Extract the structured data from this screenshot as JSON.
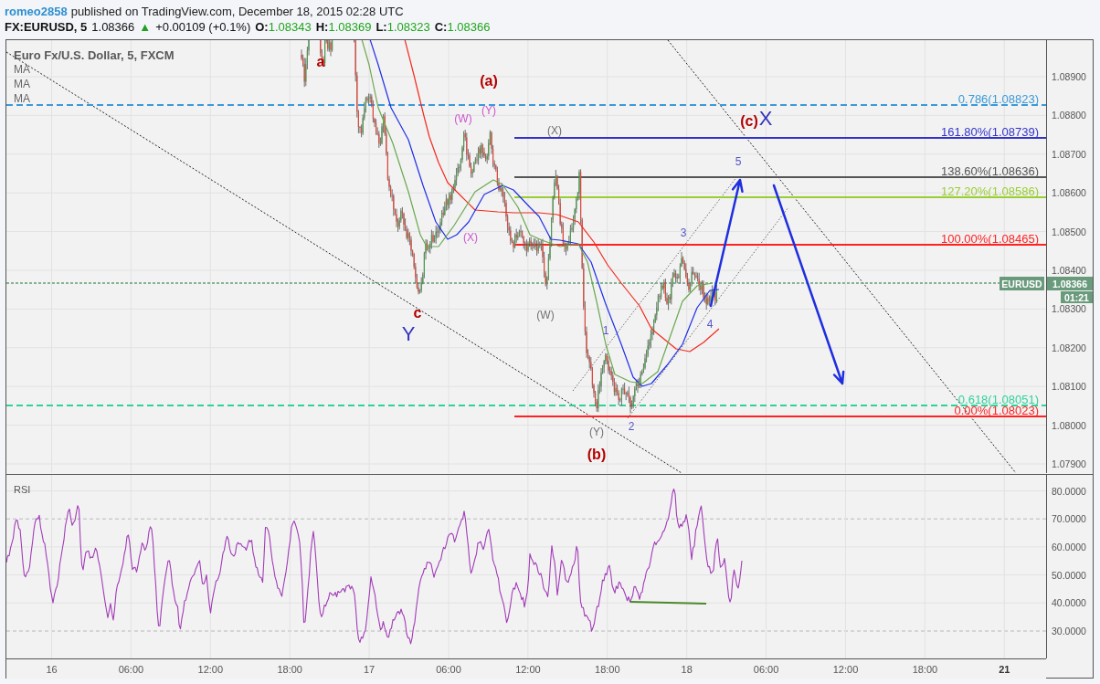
{
  "header": {
    "author": "romeo2858",
    "published": "published on TradingView.com, December 18, 2015 02:28 UTC"
  },
  "quote": {
    "symbol": "FX:EURUSD, 5",
    "last": "1.08366",
    "arrow": "▲",
    "change": "+0.00109 (+0.1%)",
    "ohlc": [
      {
        "label": "O:",
        "value": "1.08343"
      },
      {
        "label": "H:",
        "value": "1.08369"
      },
      {
        "label": "L:",
        "value": "1.08323"
      },
      {
        "label": "C:",
        "value": "1.08366"
      }
    ]
  },
  "price_pane": {
    "title": "Euro Fx/U.S. Dollar, 5, FXCM",
    "indicators": [
      "MA",
      "MA",
      "MA"
    ],
    "levels": [
      {
        "label": "0.786(1.08823)",
        "color": "#3a9ad9",
        "kind": "dashed"
      },
      {
        "label": "161.80%(1.08739)",
        "color": "#3333cc",
        "kind": "solid"
      },
      {
        "label": "138.60%(1.08636)",
        "color": "#555555",
        "kind": "solid"
      },
      {
        "label": "127.20%(1.08586)",
        "color": "#9acd32",
        "kind": "solid"
      },
      {
        "label": "100.00%(1.08465)",
        "color": "#ff2222",
        "kind": "solid"
      },
      {
        "label": "0.618(1.08051)",
        "color": "#2ed39a",
        "kind": "dashed"
      },
      {
        "label": "0.00%(1.08023)",
        "color": "#ff2222",
        "kind": "solid"
      }
    ],
    "wave_labels": [
      {
        "text": "a",
        "color": "#b30000",
        "kind": "bold"
      },
      {
        "text": "(a)",
        "color": "#b30000",
        "kind": "bold"
      },
      {
        "text": "(W)",
        "color": "#cc55cc",
        "kind": "small"
      },
      {
        "text": "(Y)",
        "color": "#cc55cc",
        "kind": "small"
      },
      {
        "text": "(c)",
        "color": "#b30000",
        "kind": "bold"
      },
      {
        "text": "X",
        "color": "#3333bb",
        "kind": "large"
      },
      {
        "text": "(X)",
        "color": "#707070",
        "kind": "small"
      },
      {
        "text": "5",
        "color": "#5555cc",
        "kind": "small"
      },
      {
        "text": "(X)",
        "color": "#cc55cc",
        "kind": "small"
      },
      {
        "text": "3",
        "color": "#5555cc",
        "kind": "small"
      },
      {
        "text": "c",
        "color": "#b30000",
        "kind": "bold"
      },
      {
        "text": "(W)",
        "color": "#707070",
        "kind": "small"
      },
      {
        "text": "4",
        "color": "#5555cc",
        "kind": "small"
      },
      {
        "text": "Y",
        "color": "#3333bb",
        "kind": "large"
      },
      {
        "text": "1",
        "color": "#5555cc",
        "kind": "small"
      },
      {
        "text": "(Y)",
        "color": "#707070",
        "kind": "small"
      },
      {
        "text": "2",
        "color": "#5555cc",
        "kind": "small"
      },
      {
        "text": "(b)",
        "color": "#b30000",
        "kind": "bold"
      }
    ],
    "price_tag": {
      "symbol": "EURUSD",
      "price": "1.08366",
      "countdown": "01:21"
    },
    "axis": [
      "1.08900",
      "1.08800",
      "1.08700",
      "1.08600",
      "1.08500",
      "1.08400",
      "1.08300",
      "1.08200",
      "1.08100",
      "1.08000",
      "1.07900"
    ]
  },
  "rsi_pane": {
    "title": "RSI",
    "axis": [
      "80.0000",
      "70.0000",
      "60.0000",
      "50.0000",
      "40.0000",
      "30.0000"
    ]
  },
  "time_axis": [
    {
      "label": "16",
      "bold": false
    },
    {
      "label": "06:00",
      "bold": false
    },
    {
      "label": "12:00",
      "bold": false
    },
    {
      "label": "18:00",
      "bold": false
    },
    {
      "label": "17",
      "bold": false
    },
    {
      "label": "06:00",
      "bold": false
    },
    {
      "label": "12:00",
      "bold": false
    },
    {
      "label": "18:00",
      "bold": false
    },
    {
      "label": "18",
      "bold": false
    },
    {
      "label": "06:00",
      "bold": false
    },
    {
      "label": "12:00",
      "bold": false
    },
    {
      "label": "18:00",
      "bold": false
    },
    {
      "label": "21",
      "bold": true
    }
  ]
}
